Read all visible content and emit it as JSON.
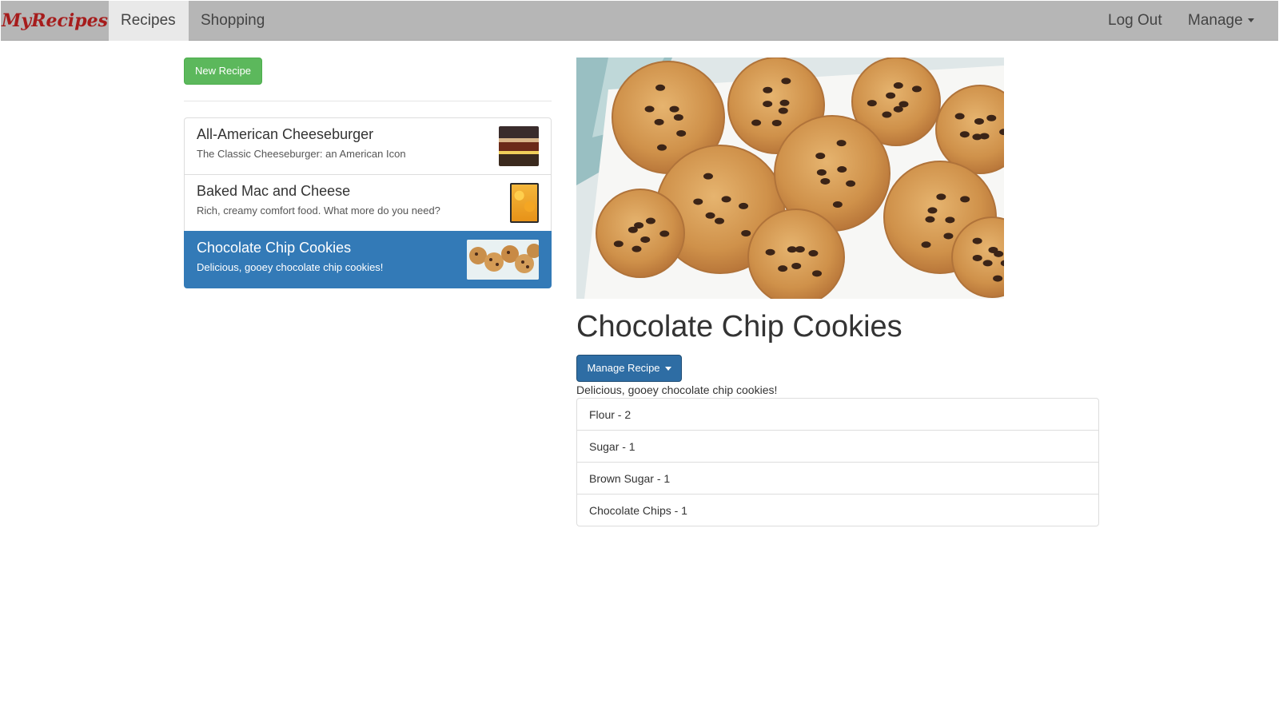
{
  "navbar": {
    "brand": "MyRecipes",
    "links": [
      {
        "label": "Recipes",
        "active": true
      },
      {
        "label": "Shopping",
        "active": false
      }
    ],
    "right": [
      {
        "label": "Log Out"
      },
      {
        "label": "Manage"
      }
    ]
  },
  "sidebar": {
    "new_button": "New Recipe",
    "recipes": [
      {
        "name": "All-American Cheeseburger",
        "description": "The Classic Cheeseburger: an American Icon",
        "active": false
      },
      {
        "name": "Baked Mac and Cheese",
        "description": "Rich, creamy comfort food. What more do you need?",
        "active": false
      },
      {
        "name": "Chocolate Chip Cookies",
        "description": "Delicious, gooey chocolate chip cookies!",
        "active": true
      }
    ]
  },
  "detail": {
    "title": "Chocolate Chip Cookies",
    "manage_button": "Manage Recipe",
    "description": "Delicious, gooey chocolate chip cookies!",
    "ingredients": [
      "Flour - 2",
      "Sugar - 1",
      "Brown Sugar - 1",
      "Chocolate Chips - 1"
    ]
  },
  "colors": {
    "navbar": "#b6b6b6",
    "brand": "#a61c1c",
    "success": "#5cb85c",
    "primary": "#337ab7",
    "primary_dark": "#2e6da4"
  }
}
